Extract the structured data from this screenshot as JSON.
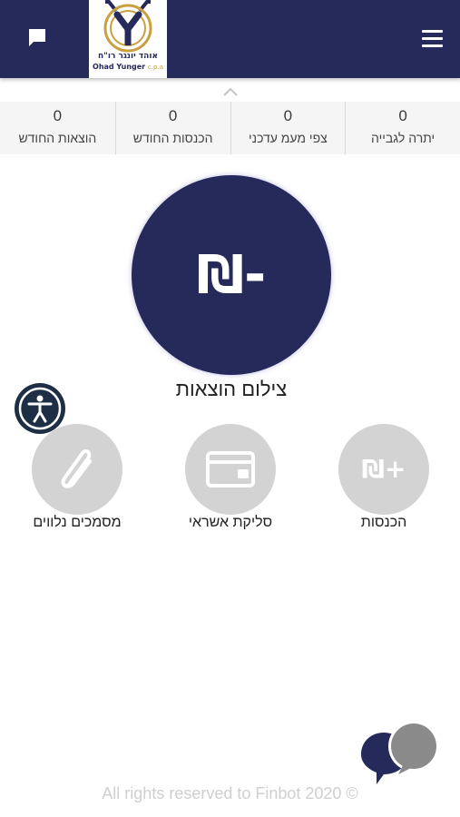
{
  "header": {
    "logo": {
      "name_he": "אוהד יונגר רו\"ח",
      "name_en": "Ohad Yunger",
      "suffix_en": "c.p.a"
    },
    "menu_icon": "hamburger-menu-icon",
    "chat_icon": "chat-bubble-icon",
    "colors": {
      "navy": "#262a5b",
      "gold": "#c8a040"
    }
  },
  "collapse_icon": "chevron-up-icon",
  "stats": [
    {
      "value": "0",
      "label": "יתרה לגבייה"
    },
    {
      "value": "0",
      "label": "צפי מעמ עדכני"
    },
    {
      "value": "0",
      "label": "הכנסות החודש"
    },
    {
      "value": "0",
      "label": "הוצאות החודש"
    }
  ],
  "main_action": {
    "glyph": "₪-",
    "label": "צילום הוצאות",
    "icon": "shekel-minus-icon"
  },
  "actions": [
    {
      "label": "הכנסות",
      "icon": "shekel-plus-icon",
      "glyph": "₪+"
    },
    {
      "label": "סליקת אשראי",
      "icon": "credit-card-icon"
    },
    {
      "label": "מסמכים נלווים",
      "icon": "paperclip-icon"
    }
  ],
  "accessibility_icon": "accessibility-icon",
  "chat_widget_icon": "chat-widget-icon",
  "footer": {
    "copyright": "All rights reserved to Finbot 2020 ©"
  }
}
